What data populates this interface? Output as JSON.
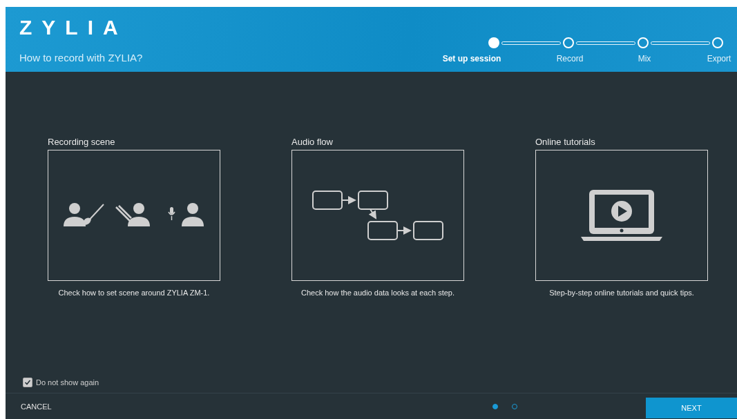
{
  "header": {
    "logo": "ZYLIA",
    "subtitle": "How to record with ZYLIA?"
  },
  "steps": [
    {
      "label": "Set up session",
      "selected": true
    },
    {
      "label": "Record",
      "selected": false
    },
    {
      "label": "Mix",
      "selected": false
    },
    {
      "label": "Export",
      "selected": false
    }
  ],
  "cards": [
    {
      "kind": "scene",
      "title": "Recording scene",
      "caption": "Check how to set scene around ZYLIA ZM-1."
    },
    {
      "kind": "flow",
      "title": "Audio flow",
      "caption": "Check how the audio data looks at each step."
    },
    {
      "kind": "tutorials",
      "title": "Online tutorials",
      "caption": "Step-by-step online tutorials and quick tips."
    }
  ],
  "do_not_show_again": {
    "label": "Do not show again",
    "checked": true
  },
  "footer": {
    "cancel": "CANCEL",
    "next": "NEXT",
    "pages": [
      {
        "selected": true
      },
      {
        "selected": false
      }
    ]
  }
}
